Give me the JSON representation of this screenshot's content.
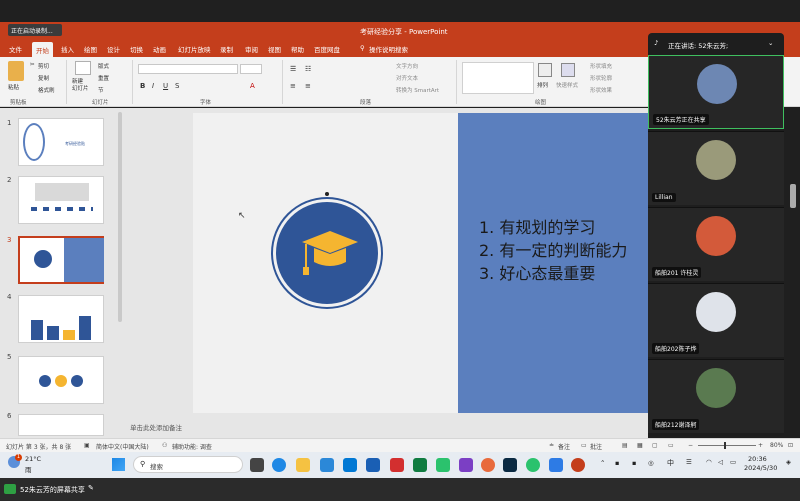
{
  "window": {
    "title": "考研经验分享 - PowerPoint",
    "recording_status": "正在启动录制..."
  },
  "ribbon_tabs": [
    "文件",
    "开始",
    "插入",
    "绘图",
    "设计",
    "切换",
    "动画",
    "幻灯片放映",
    "录制",
    "审阅",
    "视图",
    "帮助",
    "百度网盘"
  ],
  "ribbon_search": "操作说明搜索",
  "ribbon": {
    "paste": "粘贴",
    "cut": "剪切",
    "copy": "复制",
    "format_painter": "格式刷",
    "new_slide": "新建\n幻灯片",
    "layout": "版式",
    "reset": "重置",
    "section": "节",
    "text_direction": "文字方向",
    "align_text": "对齐文本",
    "smartart": "转换为 SmartArt",
    "arrange": "排列",
    "quick_styles": "快速样式",
    "shape_fill": "形状填充",
    "shape_outline": "形状轮廓",
    "shape_effects": "形状效果",
    "groups": {
      "clipboard": "剪贴板",
      "slides": "幻灯片",
      "font": "字体",
      "paragraph": "段落",
      "drawing": "绘图"
    }
  },
  "thumbnails": [
    {
      "num": "1",
      "caption": "考研经验贴"
    },
    {
      "num": "2",
      "caption": ""
    },
    {
      "num": "3",
      "caption": ""
    },
    {
      "num": "4",
      "caption": ""
    },
    {
      "num": "5",
      "caption": ""
    },
    {
      "num": "6",
      "caption": ""
    }
  ],
  "slide": {
    "bullets": [
      "1. 有规划的学习",
      "2. 有一定的判断能力",
      "3. 好心态最重要"
    ],
    "colors": {
      "panel": "#5b7fbe",
      "circle": "#2f5597",
      "cap": "#f5b530"
    }
  },
  "notes_placeholder": "单击此处添加备注",
  "statusbar": {
    "slide_info": "幻灯片 第 3 张，共 8 张",
    "language": "简体中文(中国大陆)",
    "accessibility": "辅助功能: 调查",
    "notes": "备注",
    "comments": "批注",
    "zoom": "80%"
  },
  "taskbar": {
    "weather_temp": "21°C",
    "weather_desc": "雨",
    "search_placeholder": "搜索",
    "ime": "中",
    "time": "20:36",
    "date": "2024/5/30"
  },
  "meeting": {
    "speaking": "正在讲话: 52朱云芳;",
    "participants": [
      {
        "name": "52朱云芳正在共享",
        "avatar_color": "#6d87b3"
      },
      {
        "name": "Lillian",
        "avatar_color": "#9a9a7a"
      },
      {
        "name": "船舶201 许桂灵",
        "avatar_color": "#d35a3a"
      },
      {
        "name": "船舶202陈子烨",
        "avatar_color": "#dfe3ea"
      },
      {
        "name": "船舶212谢泽舸",
        "avatar_color": "#5a7a50"
      }
    ]
  },
  "share_banner": "52朱云芳的屏幕共享"
}
